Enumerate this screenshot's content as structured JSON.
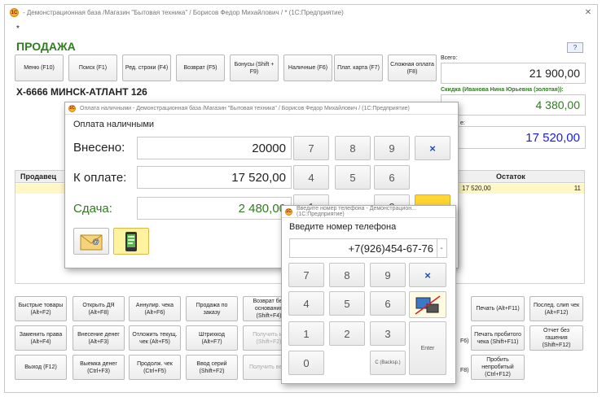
{
  "main": {
    "title": "- Демонстрационная база /Магазин \"Бытовая техника\" / Борисов Федор Михайлович / * (1С:Предприятие)",
    "asterisk": "*",
    "heading": "ПРОДАЖА",
    "toolbar": [
      {
        "label": "Меню (F10)",
        "name": "menu-button"
      },
      {
        "label": "Поиск (F1)",
        "name": "search-button"
      },
      {
        "label": "Ред. строки (F4)",
        "name": "edit-row-button"
      },
      {
        "label": "Возврат (F5)",
        "name": "return-button"
      },
      {
        "label": "Бонусы (Shift + F9)",
        "name": "bonus-button"
      },
      {
        "label": "Наличные (F6)",
        "name": "cash-button"
      },
      {
        "label": "Плат. карта (F7)",
        "name": "card-button"
      },
      {
        "label": "Сложная оплата (F8)",
        "name": "complex-payment-button"
      }
    ],
    "help_label": "?",
    "product": "Х-6666 МИНСК-АТЛАНТ 126",
    "total_label": "Всего:",
    "total_value": "21 900,00",
    "discount_label": "Скидка (Иванова Нина Юрьевна (золотая)):",
    "discount_value": "4 380,00",
    "pay_label_tail": "е:",
    "pay_value": "17 520,00",
    "table": {
      "col_seller": "Продавец",
      "col_rest": "Остаток",
      "row_amount": "17 520,00",
      "row_rest": "11"
    },
    "bottom_buttons": [
      {
        "label": "Быстрые товары (Alt+F2)",
        "name": "quick-goods-button",
        "disabled": false
      },
      {
        "label": "Открыть ДЯ (Alt+F8)",
        "name": "open-box-button",
        "disabled": false
      },
      {
        "label": "Аннулир. чека (Alt+F6)",
        "name": "cancel-receipt-button",
        "disabled": false
      },
      {
        "label": "Продажа по заказу",
        "name": "sale-by-order-button",
        "disabled": false
      },
      {
        "label": "Возврат без основания (Shift+F4)",
        "name": "return-without-basis-button",
        "disabled": false
      },
      {
        "label": "Заменить права (Alt+F4)",
        "name": "replace-rights-button",
        "disabled": false
      },
      {
        "label": "Внесение денег (Alt+F3)",
        "name": "cash-in-button",
        "disabled": false
      },
      {
        "label": "Отложить текущ. чек (Alt+F5)",
        "name": "postpone-receipt-button",
        "disabled": false
      },
      {
        "label": "Штрихкод (Alt+F7)",
        "name": "barcode-button",
        "disabled": false
      },
      {
        "label": "Получить из (Shift+F2)",
        "name": "get-from-button",
        "disabled": true
      },
      {
        "label": "Выход (F12)",
        "name": "exit-button",
        "disabled": false
      },
      {
        "label": "Выемка денег (Ctrl+F3)",
        "name": "cash-out-button",
        "disabled": false
      },
      {
        "label": "Продолж. чек (Ctrl+F5)",
        "name": "continue-receipt-button",
        "disabled": false
      },
      {
        "label": "Ввод серий (Shift+F2)",
        "name": "enter-series-button",
        "disabled": false
      },
      {
        "label": "Получить вес (",
        "name": "get-weight-button",
        "disabled": true
      }
    ],
    "right_buttons": [
      {
        "label": "Печать (Alt+F11)",
        "name": "print-button"
      },
      {
        "label": "Послед. слип чек (Alt+F12)",
        "name": "last-slip-button"
      },
      {
        "label": "Печать пробитого чека (Shift+F11)",
        "name": "print-issued-receipt-button"
      },
      {
        "label": "Отчет без гашения (Shift+F12)",
        "name": "x-report-button"
      },
      {
        "label": "Пробить непробитый (Ctrl+F12)",
        "name": "issue-unissued-button"
      }
    ],
    "edge_labels": {
      "a": "F6)",
      "b": "F8)"
    }
  },
  "cash_dialog": {
    "title": "Оплата наличными - Демонстрационная база /Магазин \"Бытовая техника\" / Борисов Федор Михайлович / (1С:Предприятие)",
    "heading": "Оплата наличными",
    "paid_label": "Внесено:",
    "paid_value": "20000",
    "due_label": "К оплате:",
    "due_value": "17 520,00",
    "change_label": "Сдача:",
    "change_value": "2 480,00",
    "keys": [
      "7",
      "8",
      "9",
      "×",
      "4",
      "5",
      "6"
    ],
    "partial_keys": [
      "1",
      "2"
    ]
  },
  "phone_dialog": {
    "title": "Введите номер телефона - Демонстрацион... (1С:Предприятие)",
    "heading": "Введите номер телефона",
    "phone_value": "+7(926)454-67-76",
    "dropdown_label": "-",
    "keys": [
      "7",
      "8",
      "9",
      "×",
      "4",
      "5",
      "6",
      "1",
      "2",
      "3",
      "0"
    ],
    "backspace_label": "С (Backsp.)",
    "enter_label": "Enter"
  },
  "colors": {
    "heading_green": "#2e7d1e",
    "discount_blue": "#1a1ae6",
    "selected_row": "#fff7c6",
    "yellow_key": "#ffd633",
    "active_icon_bg": "#fff3a0"
  }
}
